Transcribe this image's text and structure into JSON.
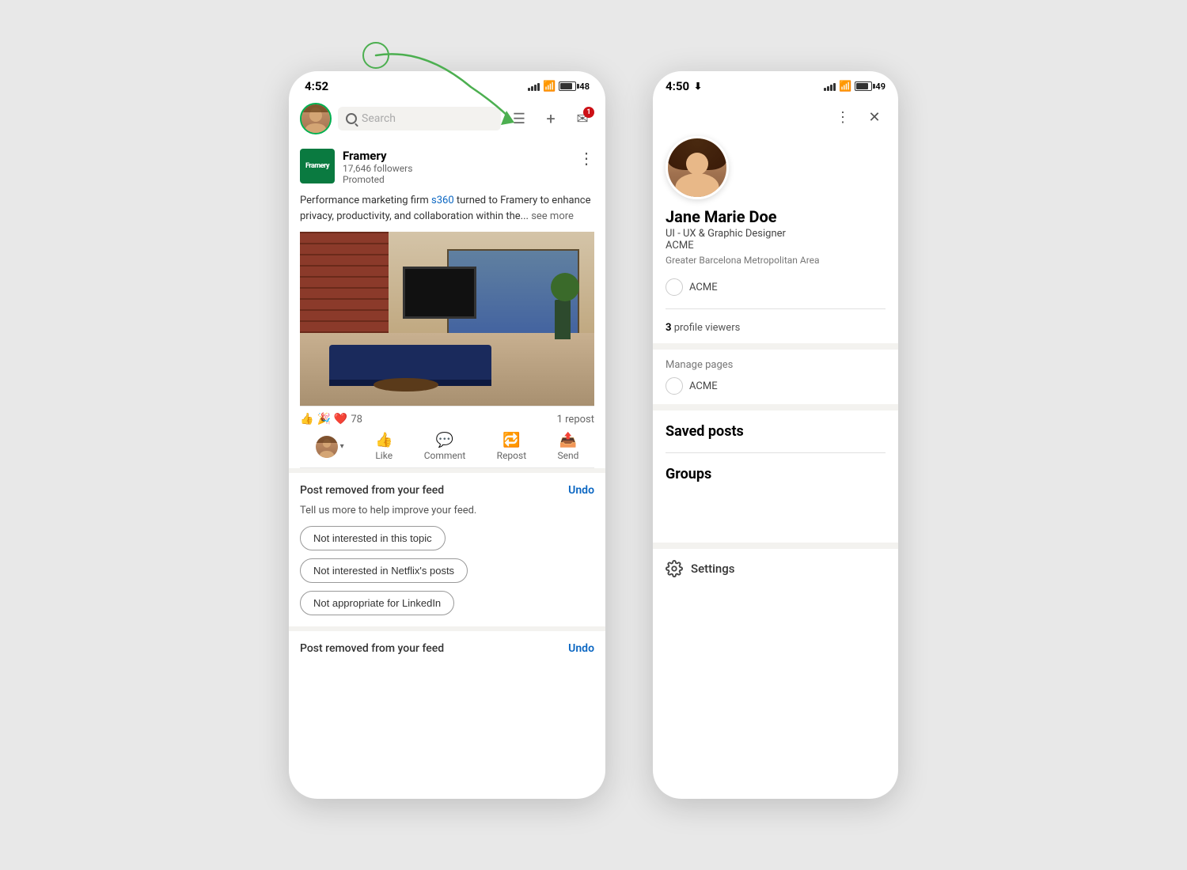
{
  "scene": {
    "background": "#e8e8e8"
  },
  "phone_left": {
    "status_bar": {
      "time": "4:52",
      "battery_level": "48"
    },
    "nav": {
      "search_placeholder": "Search",
      "message_badge": "1"
    },
    "post": {
      "company": "Framery",
      "followers": "17,646 followers",
      "promoted": "Promoted",
      "body_text": "Performance marketing firm s360 turned to Framery to enhance privacy, productivity, and collaboration within the...",
      "see_more": " see more",
      "reactions_count": "78",
      "repost_count": "1 repost",
      "actions": {
        "like": "Like",
        "comment": "Comment",
        "repost": "Repost",
        "send": "Send"
      }
    },
    "post_removed": {
      "message": "Post removed from your feed",
      "undo": "Undo",
      "improve_text": "Tell us more to help improve your feed.",
      "pills": [
        "Not interested in this topic",
        "Not interested in Netflix's posts",
        "Not appropriate for LinkedIn"
      ]
    },
    "post_removed_2": {
      "message": "Post removed from your feed",
      "undo": "Undo"
    }
  },
  "phone_right": {
    "status_bar": {
      "time": "4:50",
      "battery_level": "49"
    },
    "profile": {
      "name": "Jane Marie Doe",
      "title": "UI - UX & Graphic Designer",
      "company": "ACME",
      "location": "Greater Barcelona Metropolitan Area",
      "acme_badge": "ACME",
      "profile_viewers": "3",
      "profile_viewers_label": "profile viewers"
    },
    "manage_pages": {
      "label": "Manage pages",
      "acme": "ACME"
    },
    "saved_posts": {
      "label": "Saved posts"
    },
    "groups": {
      "label": "Groups"
    },
    "settings": {
      "label": "Settings"
    }
  }
}
